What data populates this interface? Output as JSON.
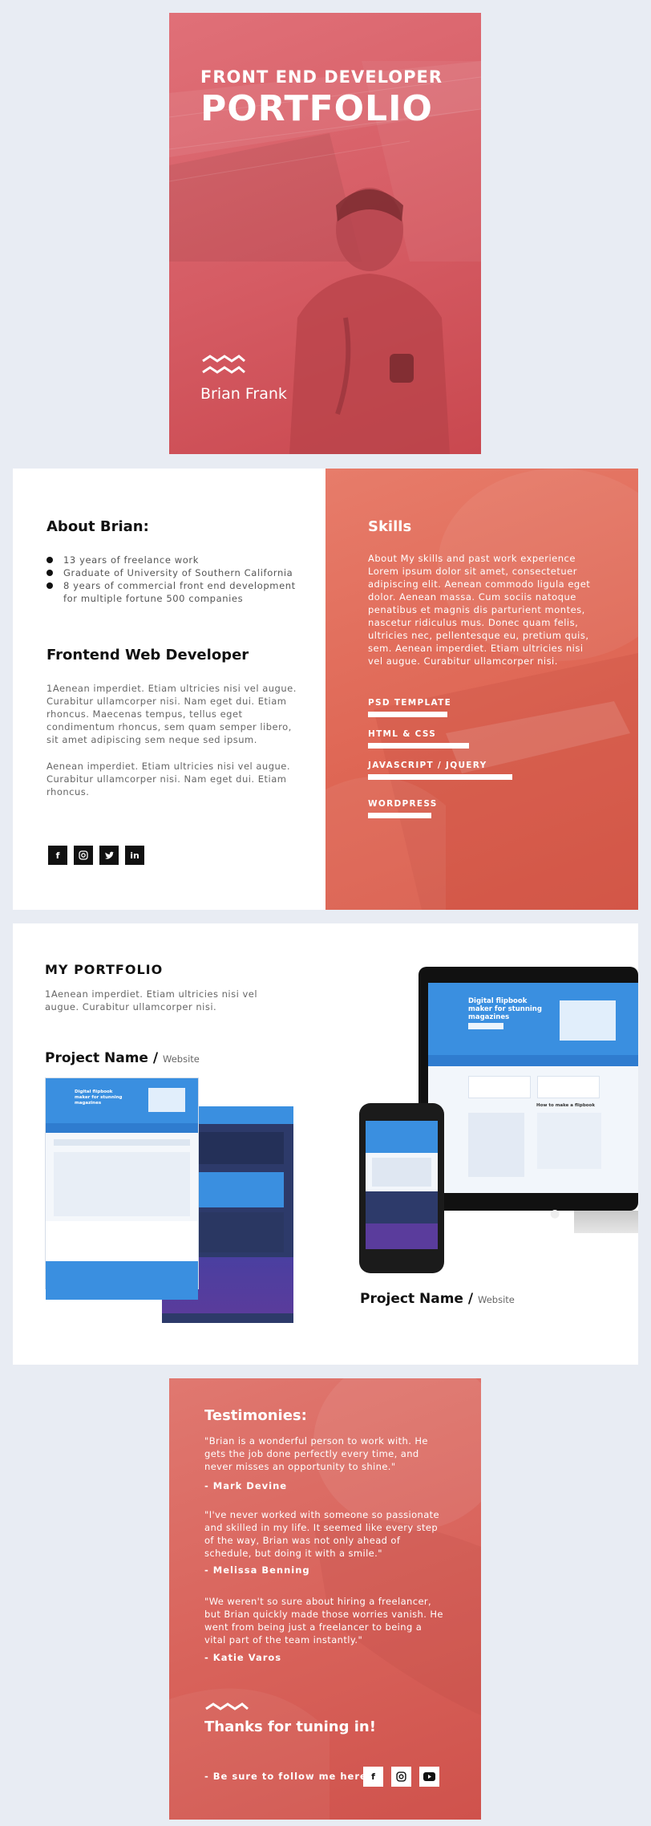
{
  "cover": {
    "subtitle": "FRONT END DEVELOPER",
    "title": "PORTFOLIO",
    "name": "Brian Frank",
    "accent": "#d55b63"
  },
  "about": {
    "heading": "About Brian:",
    "bullets": [
      "13 years of freelance work",
      "Graduate of University of Southern California",
      "8 years of commercial front end development for multiple fortune 500 companies"
    ],
    "role_heading": "Frontend Web Developer",
    "para1": "1Aenean imperdiet. Etiam ultricies nisi vel augue. Curabitur ullamcorper nisi. Nam eget dui. Etiam rhoncus. Maecenas tempus, tellus eget condimentum rhoncus, sem quam semper libero, sit amet adipiscing sem neque sed ipsum.",
    "para2": "Aenean imperdiet. Etiam ultricies nisi vel augue. Curabitur ullamcorper nisi. Nam eget dui. Etiam rhoncus.",
    "social_icons": [
      "facebook-icon",
      "instagram-icon",
      "twitter-icon",
      "linkedin-icon"
    ]
  },
  "skills": {
    "heading": "Skills",
    "text": "About My skills and past work experience Lorem ipsum dolor sit amet, consectetuer adipiscing elit. Aenean commodo ligula eget dolor. Aenean massa. Cum sociis natoque penatibus et magnis dis parturient montes, nascetur ridiculus mus. Donec quam felis, ultricies nec, pellentesque eu, pretium quis, sem. Aenean imperdiet. Etiam ultricies nisi vel augue. Curabitur ullamcorper nisi.",
    "items": [
      {
        "label": "PSD TEMPLATE",
        "level": 0.55
      },
      {
        "label": "HTML & CSS",
        "level": 0.7
      },
      {
        "label": "JAVASCRIPT / JQUERY",
        "level": 1.0
      },
      {
        "label": "WORDPRESS",
        "level": 0.44
      }
    ],
    "accent": "#de6553"
  },
  "portfolio": {
    "heading": "MY PORTFOLIO",
    "text": "1Aenean imperdiet. Etiam ultricies nisi vel augue. Curabitur ullamcorper nisi.",
    "project1": {
      "name": "Project Name /",
      "type": "Website"
    },
    "project2": {
      "name": "Project Name /",
      "type": "Website"
    },
    "mock_headline": "Digital flipbook maker for stunning magazines",
    "mock_subheading": "How to make a flipbook"
  },
  "testimonies": {
    "heading": "Testimonies:",
    "quotes": [
      {
        "text": "\"Brian is a wonderful person to work with. He gets the job done perfectly every time, and never misses an opportunity to shine.\"",
        "author": "- Mark Devine"
      },
      {
        "text": "\"I've never worked with someone so passionate and skilled in my life. It seemed like every step of the way, Brian was not only ahead of schedule, but doing it with a smile.\"",
        "author": "-  Melissa Benning"
      },
      {
        "text": "\"We weren't so sure about hiring a freelancer, but Brian quickly made those worries vanish. He went from being just a freelancer to being a vital part of the team instantly.\"",
        "author": "- Katie Varos"
      }
    ],
    "thanks": "Thanks for tuning in!",
    "follow": "- Be sure to follow me here:",
    "social_icons": [
      "facebook-icon",
      "instagram-icon",
      "youtube-icon"
    ]
  }
}
